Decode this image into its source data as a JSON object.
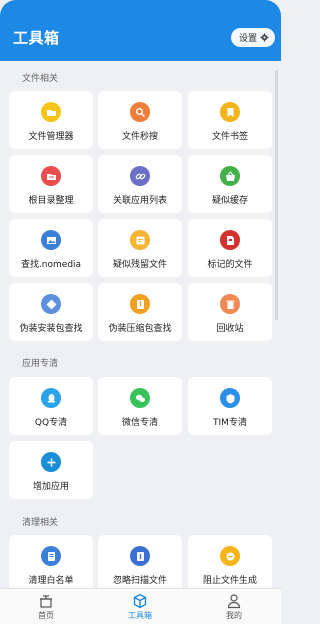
{
  "header": {
    "title": "工具箱",
    "settings_label": "设置"
  },
  "sections": [
    {
      "title": "文件相关",
      "items": [
        {
          "label": "文件管理器",
          "icon": "folder-icon",
          "color": "#f5c41a"
        },
        {
          "label": "文件秒搜",
          "icon": "search-icon",
          "color": "#ef7d3c"
        },
        {
          "label": "文件书签",
          "icon": "bookmark-icon",
          "color": "#f5b51a"
        },
        {
          "label": "根目录整理",
          "icon": "folder-sort-icon",
          "color": "#ea4d4d"
        },
        {
          "label": "关联应用列表",
          "icon": "link-icon",
          "color": "#6a6fc7"
        },
        {
          "label": "疑似缓存",
          "icon": "basket-icon",
          "color": "#43b04a"
        },
        {
          "label": "查找.nomedia",
          "icon": "image-icon",
          "color": "#3c7fd6"
        },
        {
          "label": "疑似残留文件",
          "icon": "file-residue-icon",
          "color": "#f5b533"
        },
        {
          "label": "标记的文件",
          "icon": "flag-file-icon",
          "color": "#d2322d"
        },
        {
          "label": "伪装安装包查找",
          "icon": "diamond-icon",
          "color": "#5c8fe0"
        },
        {
          "label": "伪装压缩包查找",
          "icon": "zip-icon",
          "color": "#f0a020"
        },
        {
          "label": "回收站",
          "icon": "trash-icon",
          "color": "#ef8a55"
        }
      ]
    },
    {
      "title": "应用专清",
      "items": [
        {
          "label": "QQ专清",
          "icon": "qq-icon",
          "color": "#2aa3e8"
        },
        {
          "label": "微信专清",
          "icon": "wechat-icon",
          "color": "#38c25a"
        },
        {
          "label": "TIM专清",
          "icon": "tim-icon",
          "color": "#2a8fe8"
        },
        {
          "label": "增加应用",
          "icon": "plus-icon",
          "color": "#1a8fd8"
        }
      ]
    },
    {
      "title": "清理相关",
      "items": [
        {
          "label": "清理白名单",
          "icon": "whitelist-icon",
          "color": "#3c7fd6"
        },
        {
          "label": "忽略扫描文件",
          "icon": "ignore-file-icon",
          "color": "#3c6fd6"
        },
        {
          "label": "阻止文件生成",
          "icon": "block-icon",
          "color": "#f5b51a"
        }
      ]
    }
  ],
  "nav": [
    {
      "label": "首页",
      "icon": "home-box-icon",
      "active": false
    },
    {
      "label": "工具箱",
      "icon": "toolbox-cube-icon",
      "active": true
    },
    {
      "label": "我的",
      "icon": "person-icon",
      "active": false
    }
  ],
  "colors": {
    "primary": "#1e88e5",
    "background": "#eef0f3"
  }
}
